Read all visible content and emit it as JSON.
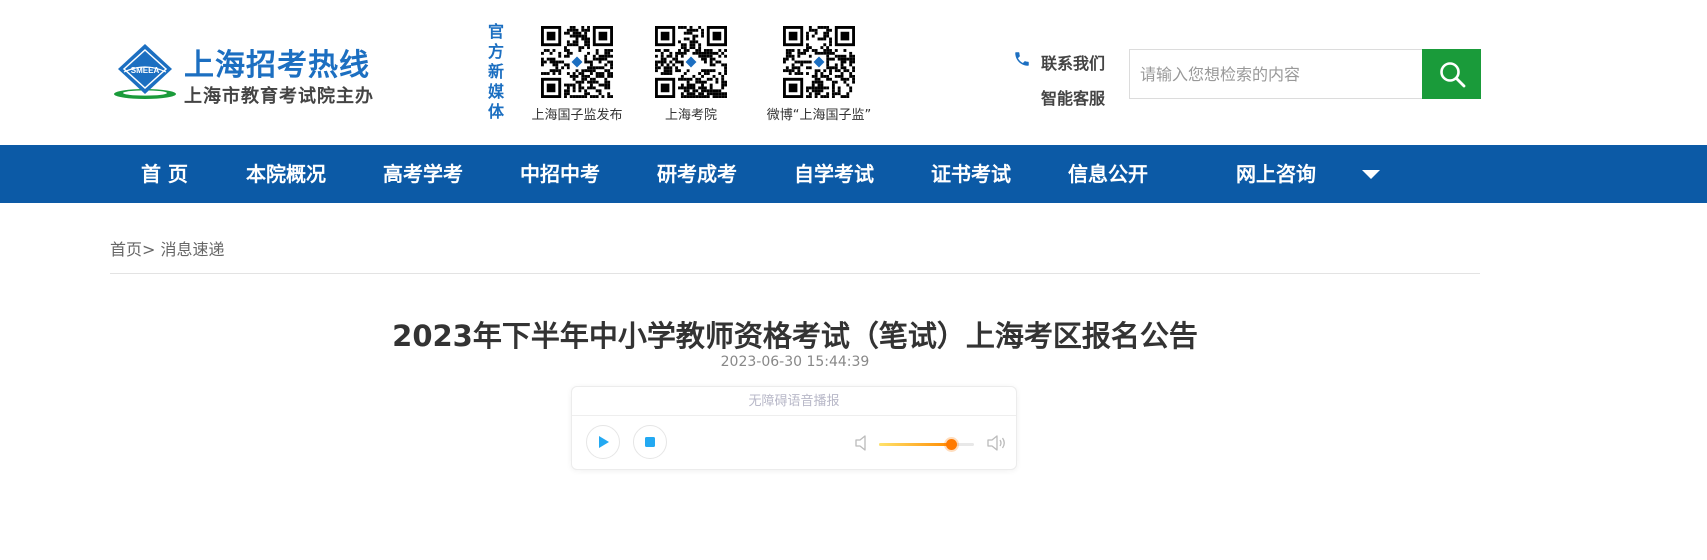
{
  "header": {
    "logo_emblem_text": "SMEEA",
    "logo_title": "上海招考热线",
    "logo_subtitle": "上海市教育考试院主办",
    "media_label": "官方新媒体",
    "qr_codes": [
      {
        "caption": "上海国子监发布"
      },
      {
        "caption": "上海考院"
      },
      {
        "caption": "微博“上海国子监”"
      }
    ],
    "contact": {
      "line1": "联系我们",
      "line2": "智能客服"
    },
    "search": {
      "placeholder": "请输入您想检索的内容",
      "value": ""
    },
    "colors": {
      "brand_blue": "#1c6fc1",
      "search_green": "#1a9b3a"
    }
  },
  "nav": {
    "items": [
      {
        "label": "首 页"
      },
      {
        "label": "本院概况"
      },
      {
        "label": "高考学考"
      },
      {
        "label": "中招中考"
      },
      {
        "label": "研考成考"
      },
      {
        "label": "自学考试"
      },
      {
        "label": "证书考试"
      },
      {
        "label": "信息公开"
      },
      {
        "label": "网上咨询"
      }
    ],
    "more_icon": "triangle-down-icon",
    "background": "#0c5aa6"
  },
  "breadcrumb": {
    "home": "首页",
    "separator": ">",
    "current": "消息速递"
  },
  "article": {
    "title": "2023年下半年中小学教师资格考试（笔试）上海考区报名公告",
    "date": "2023-06-30 15:44:39"
  },
  "player": {
    "title": "无障碍语音播报",
    "play_icon": "play-icon",
    "stop_icon": "stop-icon",
    "volume_level": 0.76
  }
}
